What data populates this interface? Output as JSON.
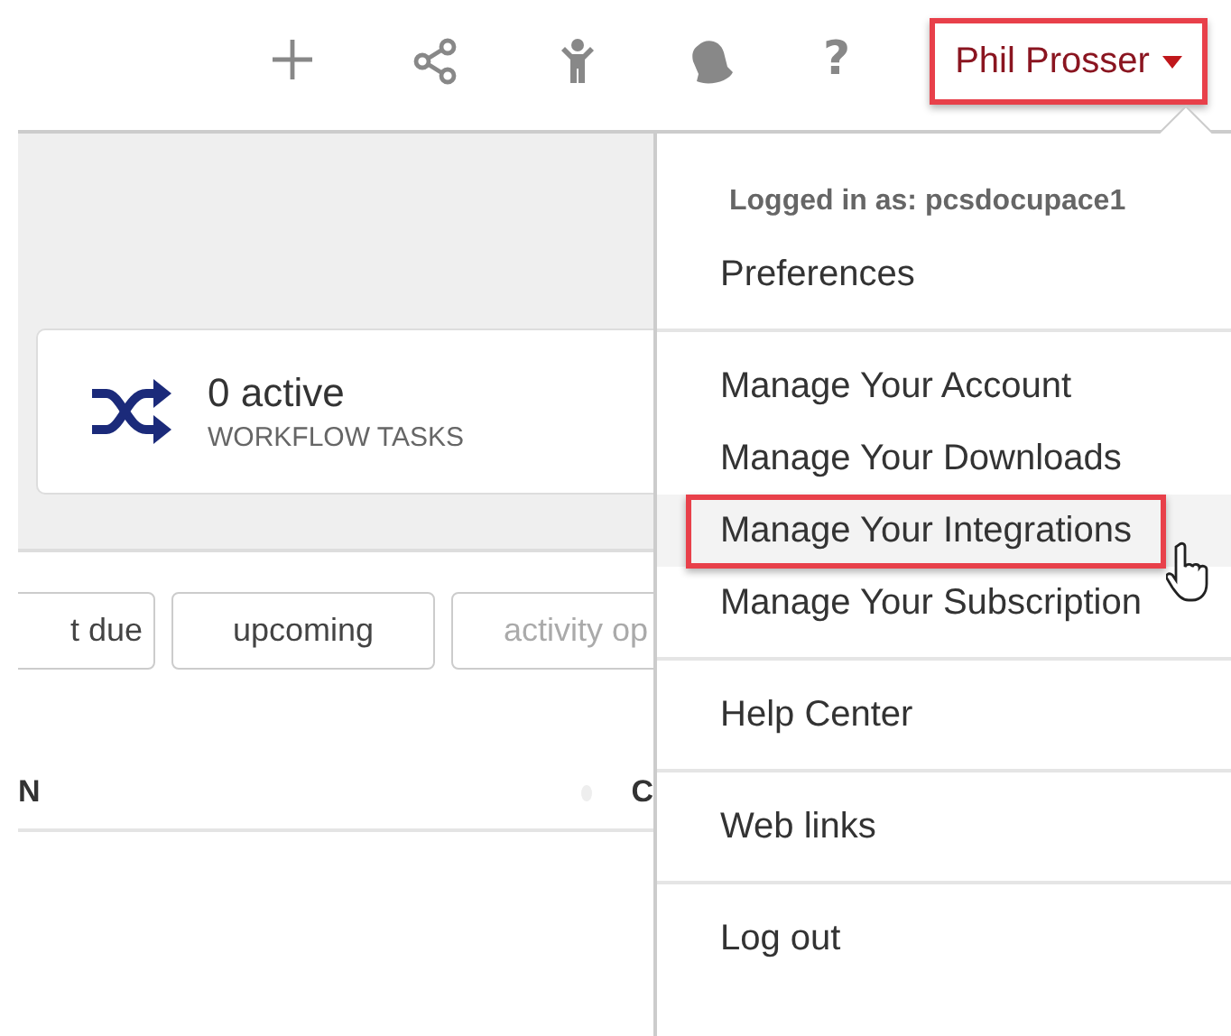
{
  "toolbar": {
    "help": "?",
    "user_menu": {
      "label": "Phil Prosser",
      "highlighted": true
    }
  },
  "summary_card": {
    "count": "0 active",
    "caption": "WORKFLOW TASKS"
  },
  "filters": [
    {
      "label": "t due",
      "disabled": false
    },
    {
      "label": "upcoming",
      "disabled": false
    },
    {
      "label": "activity op",
      "disabled": true
    }
  ],
  "table": {
    "columns": [
      "N",
      "C"
    ]
  },
  "dropdown": {
    "groups": [
      {
        "items": [
          {
            "kind": "header",
            "label": "Logged in as: pcsdocupace1",
            "highlighted": false
          },
          {
            "kind": "link",
            "label": "Preferences",
            "highlighted": false
          }
        ]
      },
      {
        "items": [
          {
            "kind": "link",
            "label": "Manage Your Account",
            "highlighted": false
          },
          {
            "kind": "link",
            "label": "Manage Your Downloads",
            "highlighted": false
          },
          {
            "kind": "link",
            "label": "Manage Your Integrations",
            "highlighted": true
          },
          {
            "kind": "link",
            "label": "Manage Your Subscription",
            "highlighted": false
          }
        ]
      },
      {
        "items": [
          {
            "kind": "link",
            "label": "Help Center",
            "highlighted": false
          }
        ]
      },
      {
        "items": [
          {
            "kind": "link",
            "label": "Web links",
            "highlighted": false
          }
        ]
      },
      {
        "items": [
          {
            "kind": "link",
            "label": "Log out",
            "highlighted": false
          }
        ]
      }
    ]
  }
}
